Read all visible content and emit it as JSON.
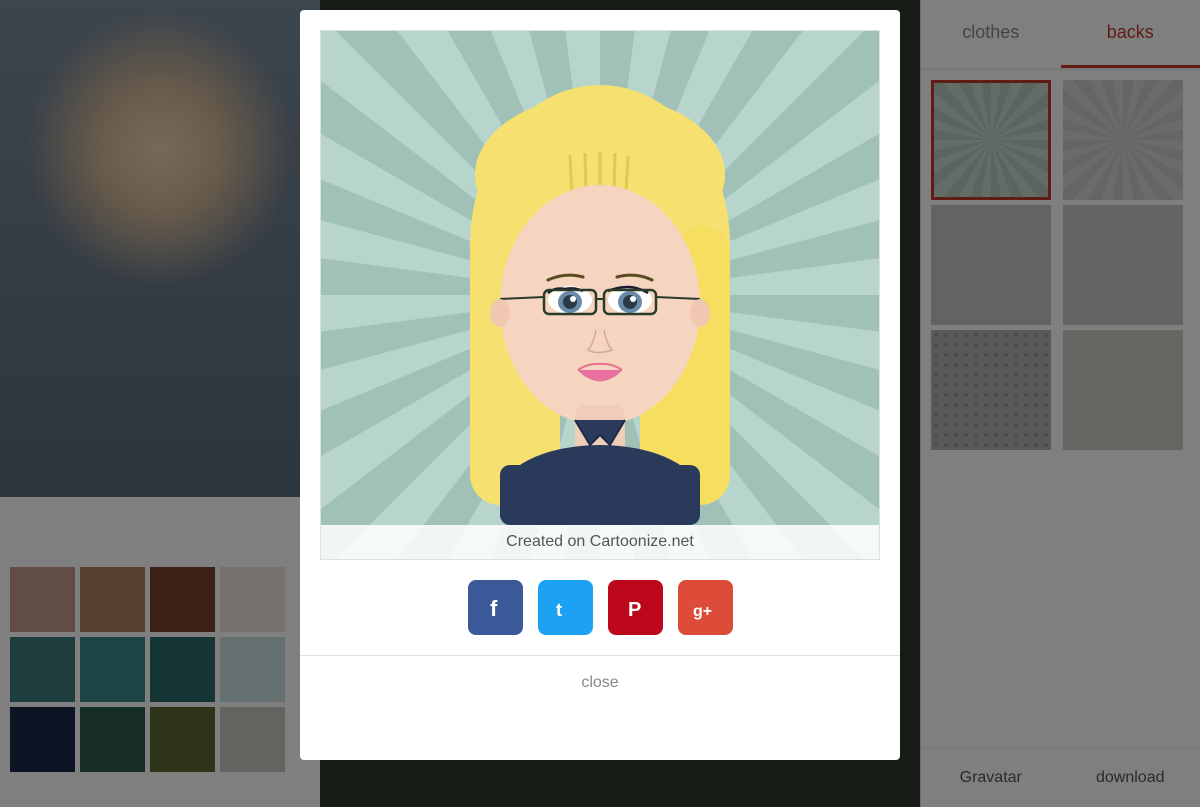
{
  "background": {
    "color": "#4a5a4a"
  },
  "right_panel": {
    "tabs": [
      {
        "id": "clothes",
        "label": "clothes",
        "active": false
      },
      {
        "id": "backs",
        "label": "backs",
        "active": true
      }
    ],
    "bottom_actions": [
      {
        "id": "gravatar",
        "label": "Gravatar"
      },
      {
        "id": "download",
        "label": "download"
      }
    ]
  },
  "nav_arrows": {
    "up": "↑",
    "down": "↓",
    "left": "←",
    "right": "→",
    "extra": "◎"
  },
  "swatches": {
    "row1": [
      "#c49a8a",
      "#b08060",
      "#7a4030",
      "#c0a090"
    ],
    "row2": [
      "#3a7878",
      "#3a8888",
      "#2a6868",
      "#4a9898"
    ],
    "row3": [
      "#1a2a4a",
      "#2a5a4a",
      "#5a6830",
      "#3a4a2a"
    ]
  },
  "modal": {
    "image_alt": "Cartoon avatar of blonde woman with glasses",
    "watermark": "Created on Cartoonize.net",
    "social": [
      {
        "id": "facebook",
        "label": "f",
        "color": "#3b5998"
      },
      {
        "id": "twitter",
        "label": "t",
        "color": "#1da1f2"
      },
      {
        "id": "pinterest",
        "label": "P",
        "color": "#bd081c"
      },
      {
        "id": "googleplus",
        "label": "g+",
        "color": "#dd4b39"
      }
    ],
    "close_label": "close"
  }
}
